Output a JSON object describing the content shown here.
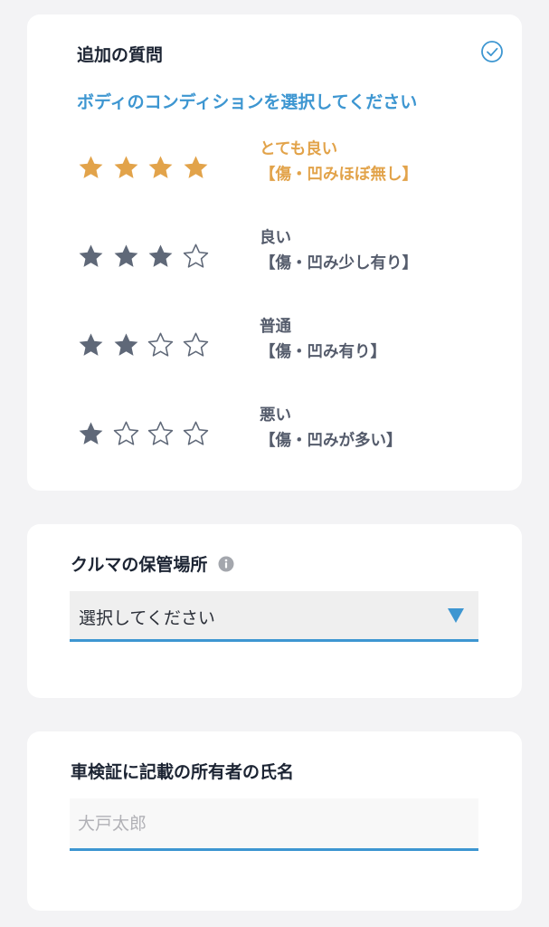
{
  "colors": {
    "accent": "#3d96d1",
    "selected": "#e2a34a",
    "star_filled": "#5f6878",
    "star_empty_stroke": "#5f6878",
    "card_bg": "#ffffff",
    "page_bg": "#f3f3f5"
  },
  "additional_question": {
    "title": "追加の質問",
    "status_icon": "check-circle-icon",
    "subtitle": "ボディのコンディションを選択してください",
    "options": [
      {
        "rating": 4,
        "max": 5,
        "line1": "とても良い",
        "line2": "【傷・凹みほぼ無し】",
        "selected": true
      },
      {
        "rating": 3,
        "max": 5,
        "line1": "良い",
        "line2": "【傷・凹み少し有り】",
        "selected": false
      },
      {
        "rating": 2,
        "max": 5,
        "line1": "普通",
        "line2": "【傷・凹み有り】",
        "selected": false
      },
      {
        "rating": 1,
        "max": 5,
        "line1": "悪い",
        "line2": "【傷・凹みが多い】",
        "selected": false
      }
    ]
  },
  "storage_location": {
    "label": "クルマの保管場所",
    "info_icon": "info-icon",
    "selected_value": "選択してください",
    "arrow_icon": "triangle-down-icon"
  },
  "owner_name": {
    "label": "車検証に記載の所有者の氏名",
    "value": "",
    "placeholder": "大戸太郎"
  }
}
